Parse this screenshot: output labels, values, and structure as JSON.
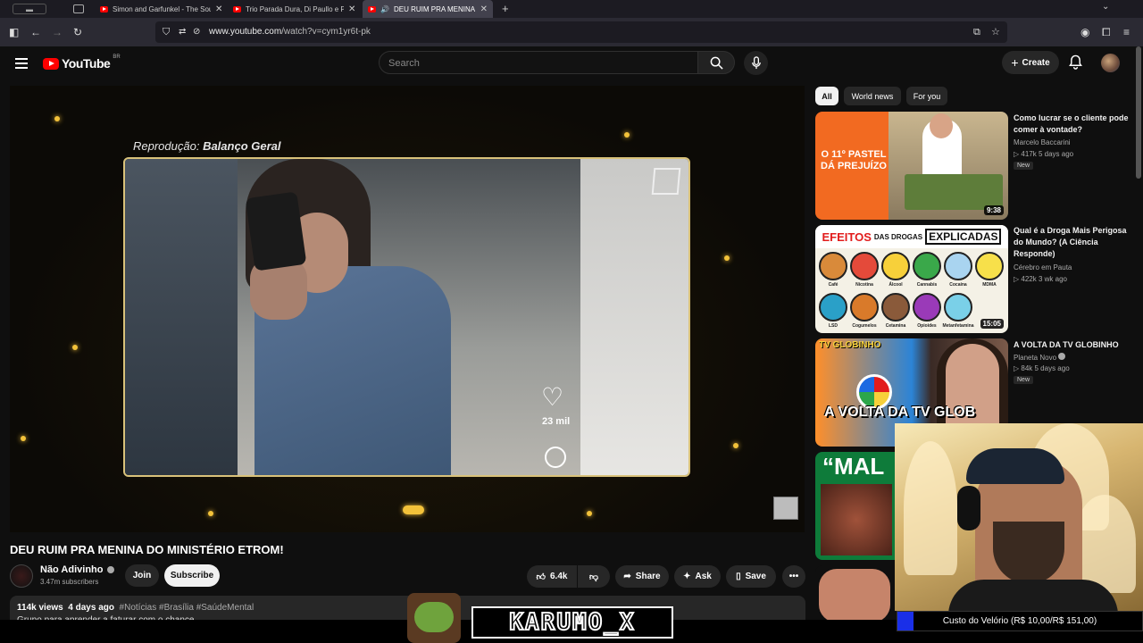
{
  "browser": {
    "tabs": [
      {
        "title": "Simon and Garfunkel - The Sou"
      },
      {
        "title": "Trio Parada Dura, Di Paullo e Pa"
      },
      {
        "title": "DEU RUIM PRA MENINA DO"
      }
    ],
    "url_host": "www.youtube.com",
    "url_path": "/watch?v=cym1yr6t-pk"
  },
  "header": {
    "logo_text": "YouTube",
    "country": "BR",
    "search_placeholder": "Search",
    "create_label": "Create"
  },
  "video": {
    "overlay_caption_prefix": "Reprodução: ",
    "overlay_caption_bold": "Balanço Geral",
    "overlay_likes": "23 mil",
    "title": "DEU RUIM PRA MENINA DO MINISTÉRIO ETROM!",
    "channel": "Não Adivinho",
    "subscribers": "3.47m subscribers",
    "join_label": "Join",
    "subscribe_label": "Subscribe",
    "like_count": "6.4k",
    "share_label": "Share",
    "ask_label": "Ask",
    "save_label": "Save",
    "views": "114k views",
    "age": "4 days ago",
    "hashtags": "#Notícias #Brasília #SaúdeMental",
    "desc_line": "Grupo para aprender a faturar com o chance"
  },
  "sidebar": {
    "chips": [
      "All",
      "World news",
      "For you"
    ],
    "items": [
      {
        "title": "Como lucrar se o cliente pode comer à vontade?",
        "channel": "Marcelo Baccarini",
        "meta": "417k  5 days ago",
        "badge": "New",
        "duration": "9:38",
        "thumb_text": "O 11º PASTEL DÁ PREJUÍZO"
      },
      {
        "title": "Qual é a Droga Mais Perigosa do Mundo? (A Ciência Responde)",
        "channel": "Cérebro em Pauta",
        "meta": "422k  3 wk ago",
        "duration": "15:05",
        "thumb_head_a": "EFEITOS",
        "thumb_head_b": "DAS DROGAS",
        "thumb_head_c": "EXPLICADAS",
        "labels": [
          "Café",
          "Nicotina",
          "Álcool",
          "Cannabis",
          "Cocaína",
          "MDMA",
          "LSD",
          "Cogumelos",
          "Cetamina",
          "Opioides",
          "Metanfetamina"
        ]
      },
      {
        "title": "A VOLTA DA TV GLOBINHO",
        "channel": "Planeta Novo",
        "meta": "84k  5 days ago",
        "badge": "New",
        "thumb_text": "A VOLTA DA TV GLOB",
        "thumb_top": "TV GLOBINHO"
      },
      {
        "thumb_text": "“MAL"
      },
      {}
    ]
  },
  "overlay": {
    "brand": "KARUMO_X",
    "cost_label": "Custo do Velório (R$ 10,00/R$ 151,00)",
    "cost_progress_fraction": 0.066
  },
  "colors": {
    "yt_red": "#ff0000",
    "accent_gold": "#f3c23a",
    "cost_bar": "#1a2fe8"
  }
}
